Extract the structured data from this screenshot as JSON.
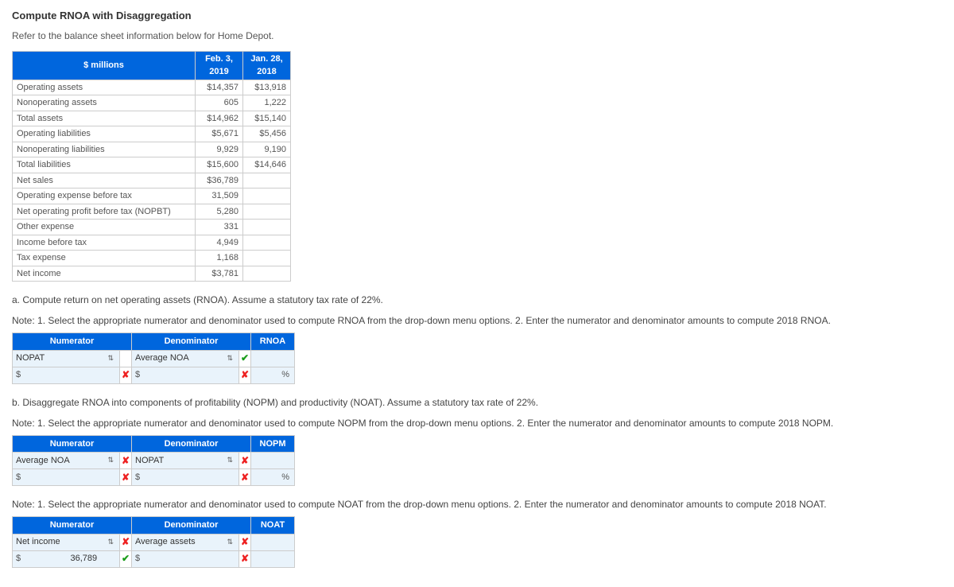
{
  "title": "Compute RNOA with Disaggregation",
  "subtitle": "Refer to the balance sheet information below for Home Depot.",
  "balance": {
    "headers": {
      "col1": "$ millions",
      "col2": "Feb. 3, 2019",
      "col3": "Jan. 28, 2018"
    },
    "rows": [
      {
        "label": "Operating assets",
        "c2": "$14,357",
        "c3": "$13,918"
      },
      {
        "label": "Nonoperating assets",
        "c2": "605",
        "c3": "1,222"
      },
      {
        "label": "Total assets",
        "c2": "$14,962",
        "c3": "$15,140"
      },
      {
        "label": "Operating liabilities",
        "c2": "$5,671",
        "c3": "$5,456"
      },
      {
        "label": "Nonoperating liabilities",
        "c2": "9,929",
        "c3": "9,190"
      },
      {
        "label": "Total liabilities",
        "c2": "$15,600",
        "c3": "$14,646"
      },
      {
        "label": "Net sales",
        "c2": "$36,789",
        "c3": ""
      },
      {
        "label": "Operating expense before tax",
        "c2": "31,509",
        "c3": ""
      },
      {
        "label": "Net operating profit before tax (NOPBT)",
        "c2": "5,280",
        "c3": ""
      },
      {
        "label": "Other expense",
        "c2": "331",
        "c3": ""
      },
      {
        "label": "Income before tax",
        "c2": "4,949",
        "c3": ""
      },
      {
        "label": "Tax expense",
        "c2": "1,168",
        "c3": ""
      },
      {
        "label": "Net income",
        "c2": "$3,781",
        "c3": ""
      }
    ]
  },
  "partA": {
    "intro": "a. Compute return on net operating assets (RNOA). Assume a statutory tax rate of 22%.",
    "note": "Note: 1. Select the appropriate numerator and denominator used to compute RNOA from the drop-down menu options. 2. Enter the numerator and denominator amounts to compute 2018 RNOA.",
    "headers": {
      "num": "Numerator",
      "den": "Denominator",
      "res": "RNOA"
    },
    "row1": {
      "numSel": "NOPAT",
      "numMark": "",
      "denSel": "Average NOA",
      "denMark": "✔"
    },
    "row2": {
      "numVal": "",
      "numMark": "✘",
      "denVal": "",
      "denMark": "✘",
      "pct": "%"
    },
    "dollar": "$"
  },
  "partB": {
    "intro": "b. Disaggregate RNOA into components of profitability (NOPM) and productivity (NOAT). Assume a statutory tax rate of 22%.",
    "note": "Note: 1. Select the appropriate numerator and denominator used to compute NOPM from the drop-down menu options. 2. Enter the numerator and denominator amounts to compute 2018 NOPM.",
    "headers": {
      "num": "Numerator",
      "den": "Denominator",
      "res": "NOPM"
    },
    "row1": {
      "numSel": "Average NOA",
      "numMark": "",
      "denSel": "NOPAT",
      "denMark": "✘"
    },
    "row2": {
      "numVal": "",
      "numMark": "✘",
      "denVal": "",
      "denMark": "✘",
      "pct": "%"
    },
    "dollar": "$"
  },
  "partC": {
    "note": "Note: 1. Select the appropriate numerator and denominator used to compute NOAT from the drop-down menu options. 2. Enter the numerator and denominator amounts to compute 2018 NOAT.",
    "headers": {
      "num": "Numerator",
      "den": "Denominator",
      "res": "NOAT"
    },
    "row1": {
      "numSel": "Net income",
      "numMark": "",
      "denSel": "Average assets",
      "denMark": "✘"
    },
    "row2": {
      "numVal": "36,789",
      "numMark": "✔",
      "denVal": "",
      "denMark": "✘",
      "pct": ""
    },
    "dollar": "$"
  },
  "arrows": "⇅"
}
